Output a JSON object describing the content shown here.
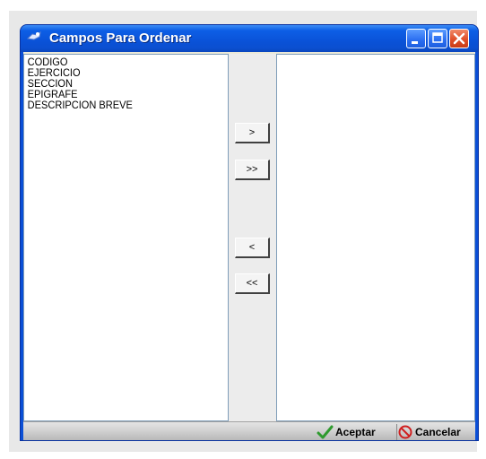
{
  "window": {
    "title": "Campos Para Ordenar",
    "icon": "app-icon"
  },
  "titlebar_buttons": {
    "minimize": "minimize-icon",
    "maximize": "maximize-icon",
    "close": "close-icon"
  },
  "left_list": {
    "items": [
      "CODIGO",
      "EJERCICIO",
      "SECCION",
      "EPIGRAFE",
      "DESCRIPCION BREVE"
    ]
  },
  "right_list": {
    "items": []
  },
  "move_buttons": {
    "move_one_right": ">",
    "move_all_right": ">>",
    "move_one_left": "<",
    "move_all_left": "<<"
  },
  "footer": {
    "accept_label": "Aceptar",
    "accept_icon": "checkmark-icon",
    "cancel_label": "Cancelar",
    "cancel_icon": "cancel-icon"
  },
  "colors": {
    "titlebar": "#0a52d8",
    "close_button": "#e0502a",
    "accept_check": "#2e9a2e",
    "cancel_icon": "#d02020"
  }
}
